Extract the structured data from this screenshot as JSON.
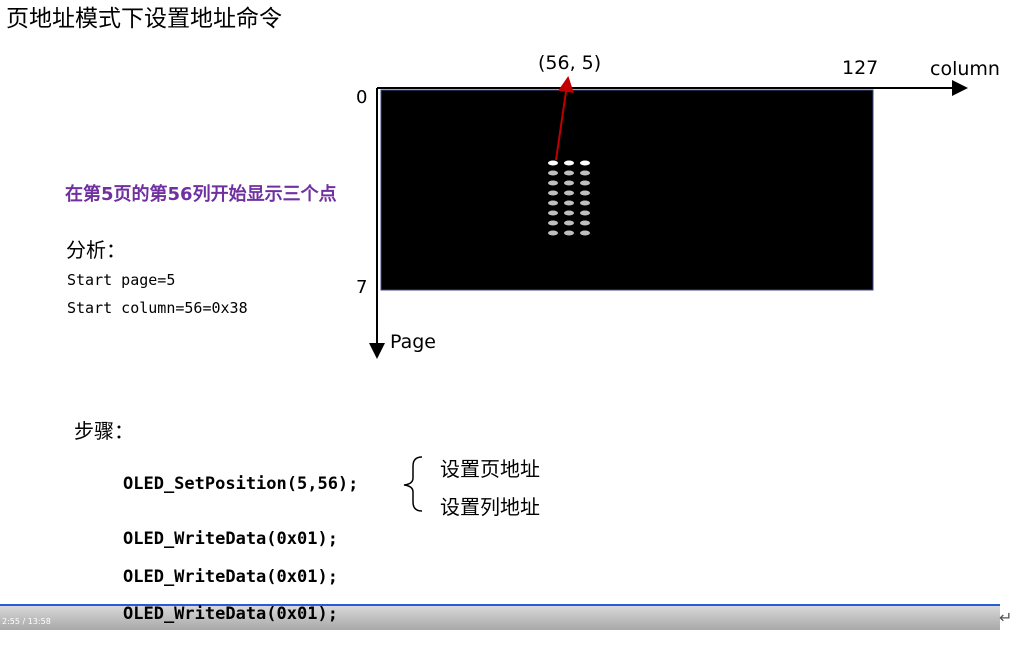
{
  "title": "页地址模式下设置地址命令",
  "diagram": {
    "col_axis_label": "column",
    "page_axis_label": "Page",
    "tick_col_max": "127",
    "tick_page_min": "0",
    "tick_page_max": "7",
    "coord_label": "(56, 5)",
    "dot_columns": 3,
    "dot_rows": 8
  },
  "task": "在第5页的第56列开始显示三个点",
  "analysis": {
    "title": "分析：",
    "lines": [
      "Start page=5",
      "Start column=56=0x38"
    ]
  },
  "steps": {
    "title": "步骤：",
    "code": [
      "OLED_SetPosition(5,56);",
      "OLED_WriteData(0x01);",
      "OLED_WriteData(0x01);",
      "OLED_WriteData(0x01);"
    ],
    "notes": [
      "设置页地址",
      "设置列地址"
    ]
  },
  "player": {
    "time": "2:55 / 13:58",
    "accent": "#2a5bd7"
  }
}
